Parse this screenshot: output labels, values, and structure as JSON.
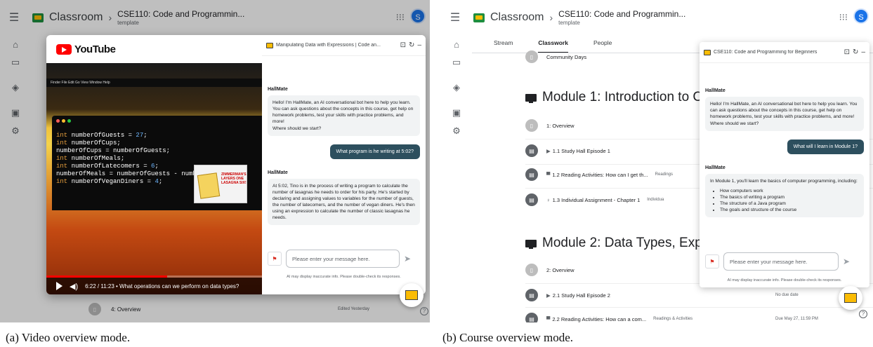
{
  "classroom": {
    "app_name": "Classroom",
    "course_name": "CSE110: Code and Programmin...",
    "course_sub": "template",
    "avatar_letter": "S"
  },
  "panel_a": {
    "caption": "(a) Video overview mode.",
    "youtube_word": "YouTube",
    "mac_menubar": "Finder   File   Edit   Go   View   Window   Help",
    "code_lines": [
      {
        "kw": "int",
        "rest": " numberOfGuests = ",
        "num": "27",
        "end": ";"
      },
      {
        "kw": "int",
        "rest": " numberOfCups;",
        "num": "",
        "end": ""
      },
      {
        "kw": "",
        "rest": "numberOfCups = numberOfGuests;",
        "num": "",
        "end": ""
      },
      {
        "kw": "int",
        "rest": " numberOfMeals;",
        "num": "",
        "end": ""
      },
      {
        "kw": "int",
        "rest": " numberOfLatecomers = ",
        "num": "6",
        "end": ";"
      },
      {
        "kw": "",
        "rest": "numberOfMeals = numberOfGuests - number",
        "num": "",
        "end": ""
      },
      {
        "kw": "int",
        "rest": " numberOfVeganDiners = ",
        "num": "4",
        "end": ";"
      }
    ],
    "book_text": "ZIMMERMAN'S LAYERS ONE LASAGNA SIX!",
    "video_time": "6:22 / 11:23 • What operations can we perform on data types?",
    "video_progress": 0.56,
    "chat": {
      "title": "Manipulating Data with Expressions | Code an...",
      "bot_name": "HallMate",
      "greeting": [
        "Hello! I'm HallMate, an AI conversational bot here to help you learn. You can ask questions about the concepts in this course, get help on homework problems, test your skills with practice problems, and more!",
        "Where should we start?"
      ],
      "user_message": "What program is he writing at 5:02?",
      "reply": "At 5:02, Tino is in the process of writing a program to calculate the number of lasagnas he needs to order for his party. He's started by declaring and assigning values to variables for the number of guests, the number of latecomers, and the number of vegan diners. He's then using an expression to calculate the number of classic lasagnas he needs.",
      "input_placeholder": "Please enter your message here.",
      "disclaimer": "AI may display inaccurate info. Please double-check its responses."
    },
    "bottom_row": {
      "label": "4: Overview",
      "right": "Edited Yesterday"
    }
  },
  "panel_b": {
    "caption": "(b) Course overview mode.",
    "tabs": [
      "Stream",
      "Classwork",
      "People"
    ],
    "items": {
      "community": "Community Days",
      "module1": "Module 1: Introduction to C",
      "m1_overview": "1: Overview",
      "m1_study": "1.1 Study Hall Episode 1",
      "m1_reading": "1.2 Reading Activities: How can I get th...",
      "m1_reading_cat": "Readings",
      "m1_assign": "1.3 Individual Assignment - Chapter 1",
      "m1_assign_cat": "Individua",
      "module2": "Module 2: Data Types, Expr",
      "m2_overview": "2: Overview",
      "m2_study": "2.1 Study Hall Episode 2",
      "m2_study_due": "No due date",
      "m2_reading": "2.2 Reading Activities: How can a com...",
      "m2_reading_cat": "Readings & Activities",
      "m2_reading_due": "Due May 27, 11:59 PM"
    },
    "chat": {
      "title": "CSE110: Code and Programming for Beginners",
      "bot_name": "HallMate",
      "greeting": "Hello! I'm HallMate, an AI conversational bot here to help you learn. You can ask questions about the concepts in this course, get help on homework problems, test your skills with practice problems, and more!",
      "greeting_2": "Where should we start?",
      "user_message": "What will I learn in Module 1?",
      "reply_intro": "In Module 1, you'll learn the basics of computer programming, including:",
      "reply_bullets": [
        "How computers work",
        "The basics of writing a program",
        "The structure of a Java program",
        "The goals and structure of the course"
      ],
      "input_placeholder": "Please enter your message here.",
      "disclaimer": "AI may display inaccurate info. Please double-check its responses."
    }
  },
  "colors": {
    "accent": "#1a73e8",
    "user_bubble": "#2d4f5e",
    "youtube_red": "#ff0000"
  }
}
